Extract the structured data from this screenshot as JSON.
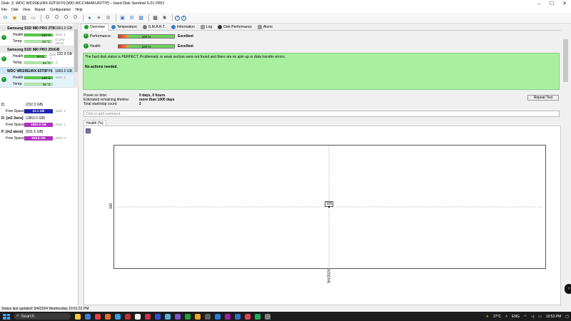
{
  "window": {
    "title": "Disk: 3, WDC  WD20EURX-63T0FY0 [WD-WCC4M4KUN7TP]  –  Hard Disk Sentinel 6.01 PRO",
    "controls": {
      "minimize": "–",
      "maximize": "☐",
      "close": "✕"
    }
  },
  "menu": [
    "File",
    "Disk",
    "View",
    "Report",
    "Configuration",
    "Help"
  ],
  "toolbar": {
    "icons": [
      "refresh-icon",
      "disk-scan-icon",
      "surface-test-icon",
      "report-icon",
      "save-report-icon",
      "send-report-icon",
      "print-icon",
      "mail-icon",
      "globe-icon",
      "alert-icon",
      "config-icon",
      "disk-icon",
      "settings-icon",
      "monitor-icon",
      "statistics-icon",
      "help-icon",
      "info-icon"
    ]
  },
  "disks": [
    {
      "name": "Samsung SSD 980 PRO 2TB",
      "capacity": "1863.0 GB",
      "health": "100 %",
      "health_label": "Health:",
      "temp": "33 °C",
      "temp_label": "Temp:",
      "side1": "Disk: 1",
      "side2": "D:,[m2 2tera]"
    },
    {
      "name": "Samsung SSD 980 PRO 250GB",
      "capacity": "232.9 GB",
      "health": "94 %",
      "health_label": "Health:",
      "temp": "34 °C",
      "temp_label": "Temp.:",
      "side1": "Disk: 2",
      "side2": "C:"
    },
    {
      "name": "WDC  WD20EURX-63T0FY0",
      "capacity": "1863.0 GB",
      "health": "100 %",
      "health_label": "Health:",
      "temp": "28 °C",
      "temp_label": "Temp:",
      "side1": "Disk: 3",
      "side2": ""
    }
  ],
  "partitions": [
    {
      "drive": "C:",
      "size": "(232.3 GB)",
      "free_label": "Free Space",
      "free": "21.1 GB",
      "disk": "Disk: 2",
      "color": "#2020b0"
    },
    {
      "drive": "D: [m2 2tera]",
      "size": "(1863.0 GB)",
      "free_label": "Free Space",
      "free": "1862.9 GB",
      "disk": "Disk: 1",
      "color": "#b030c0"
    },
    {
      "drive": "F: [m2 atera]",
      "size": "(931.5 GB)",
      "free_label": "Free Space",
      "free": "926.8 GB",
      "disk": "Disk: 0",
      "color": "#b030c0"
    }
  ],
  "tabs": [
    {
      "label": "Overview",
      "color": "#1a9c2c"
    },
    {
      "label": "Temperature",
      "color": "#3a7bd5"
    },
    {
      "label": "S.M.A.R.T.",
      "color": "#555"
    },
    {
      "label": "Information",
      "color": "#3a7bd5"
    },
    {
      "label": "Log",
      "color": "#888"
    },
    {
      "label": "Disk Performance",
      "color": "#333"
    },
    {
      "label": "Alerts",
      "color": "#888"
    }
  ],
  "performance": {
    "label": "Performance:",
    "value": "100 %",
    "level": 1.0,
    "rating": "Excellent"
  },
  "health": {
    "label": "Health:",
    "value": "100 %",
    "level": 1.0,
    "rating": "Excellent"
  },
  "status_text": "The hard disk status is PERFECT. Problematic or weak sectors were not found and there are no spin up or data transfer errors.",
  "actions_text": "No actions needed.",
  "info": {
    "power_on_label": "Power on time:",
    "power_on": "0 days, 0 hours",
    "lifetime_label": "Estimated remaining lifetime:",
    "lifetime": "more than 1000 days",
    "startstop_label": "Total start/stop count:",
    "startstop": "2"
  },
  "repeat_test": "Repeat Test",
  "comment_placeholder": "Click to add comment ...",
  "health_tab": "Health (%)",
  "chart_data": {
    "type": "line",
    "x": [
      "9/4/2024"
    ],
    "series": [
      {
        "values": [
          100
        ]
      }
    ],
    "ylabel_tick": "100",
    "xlabel_tick": "9/4/2024",
    "point_label": "100"
  },
  "statusbar": "Status last updated: 9/4/2024 Wednesday 10:51:31 PM",
  "taskbar": {
    "search": "Search",
    "weather": "27°C",
    "lang": "ENG",
    "time": "10:53 PM"
  }
}
